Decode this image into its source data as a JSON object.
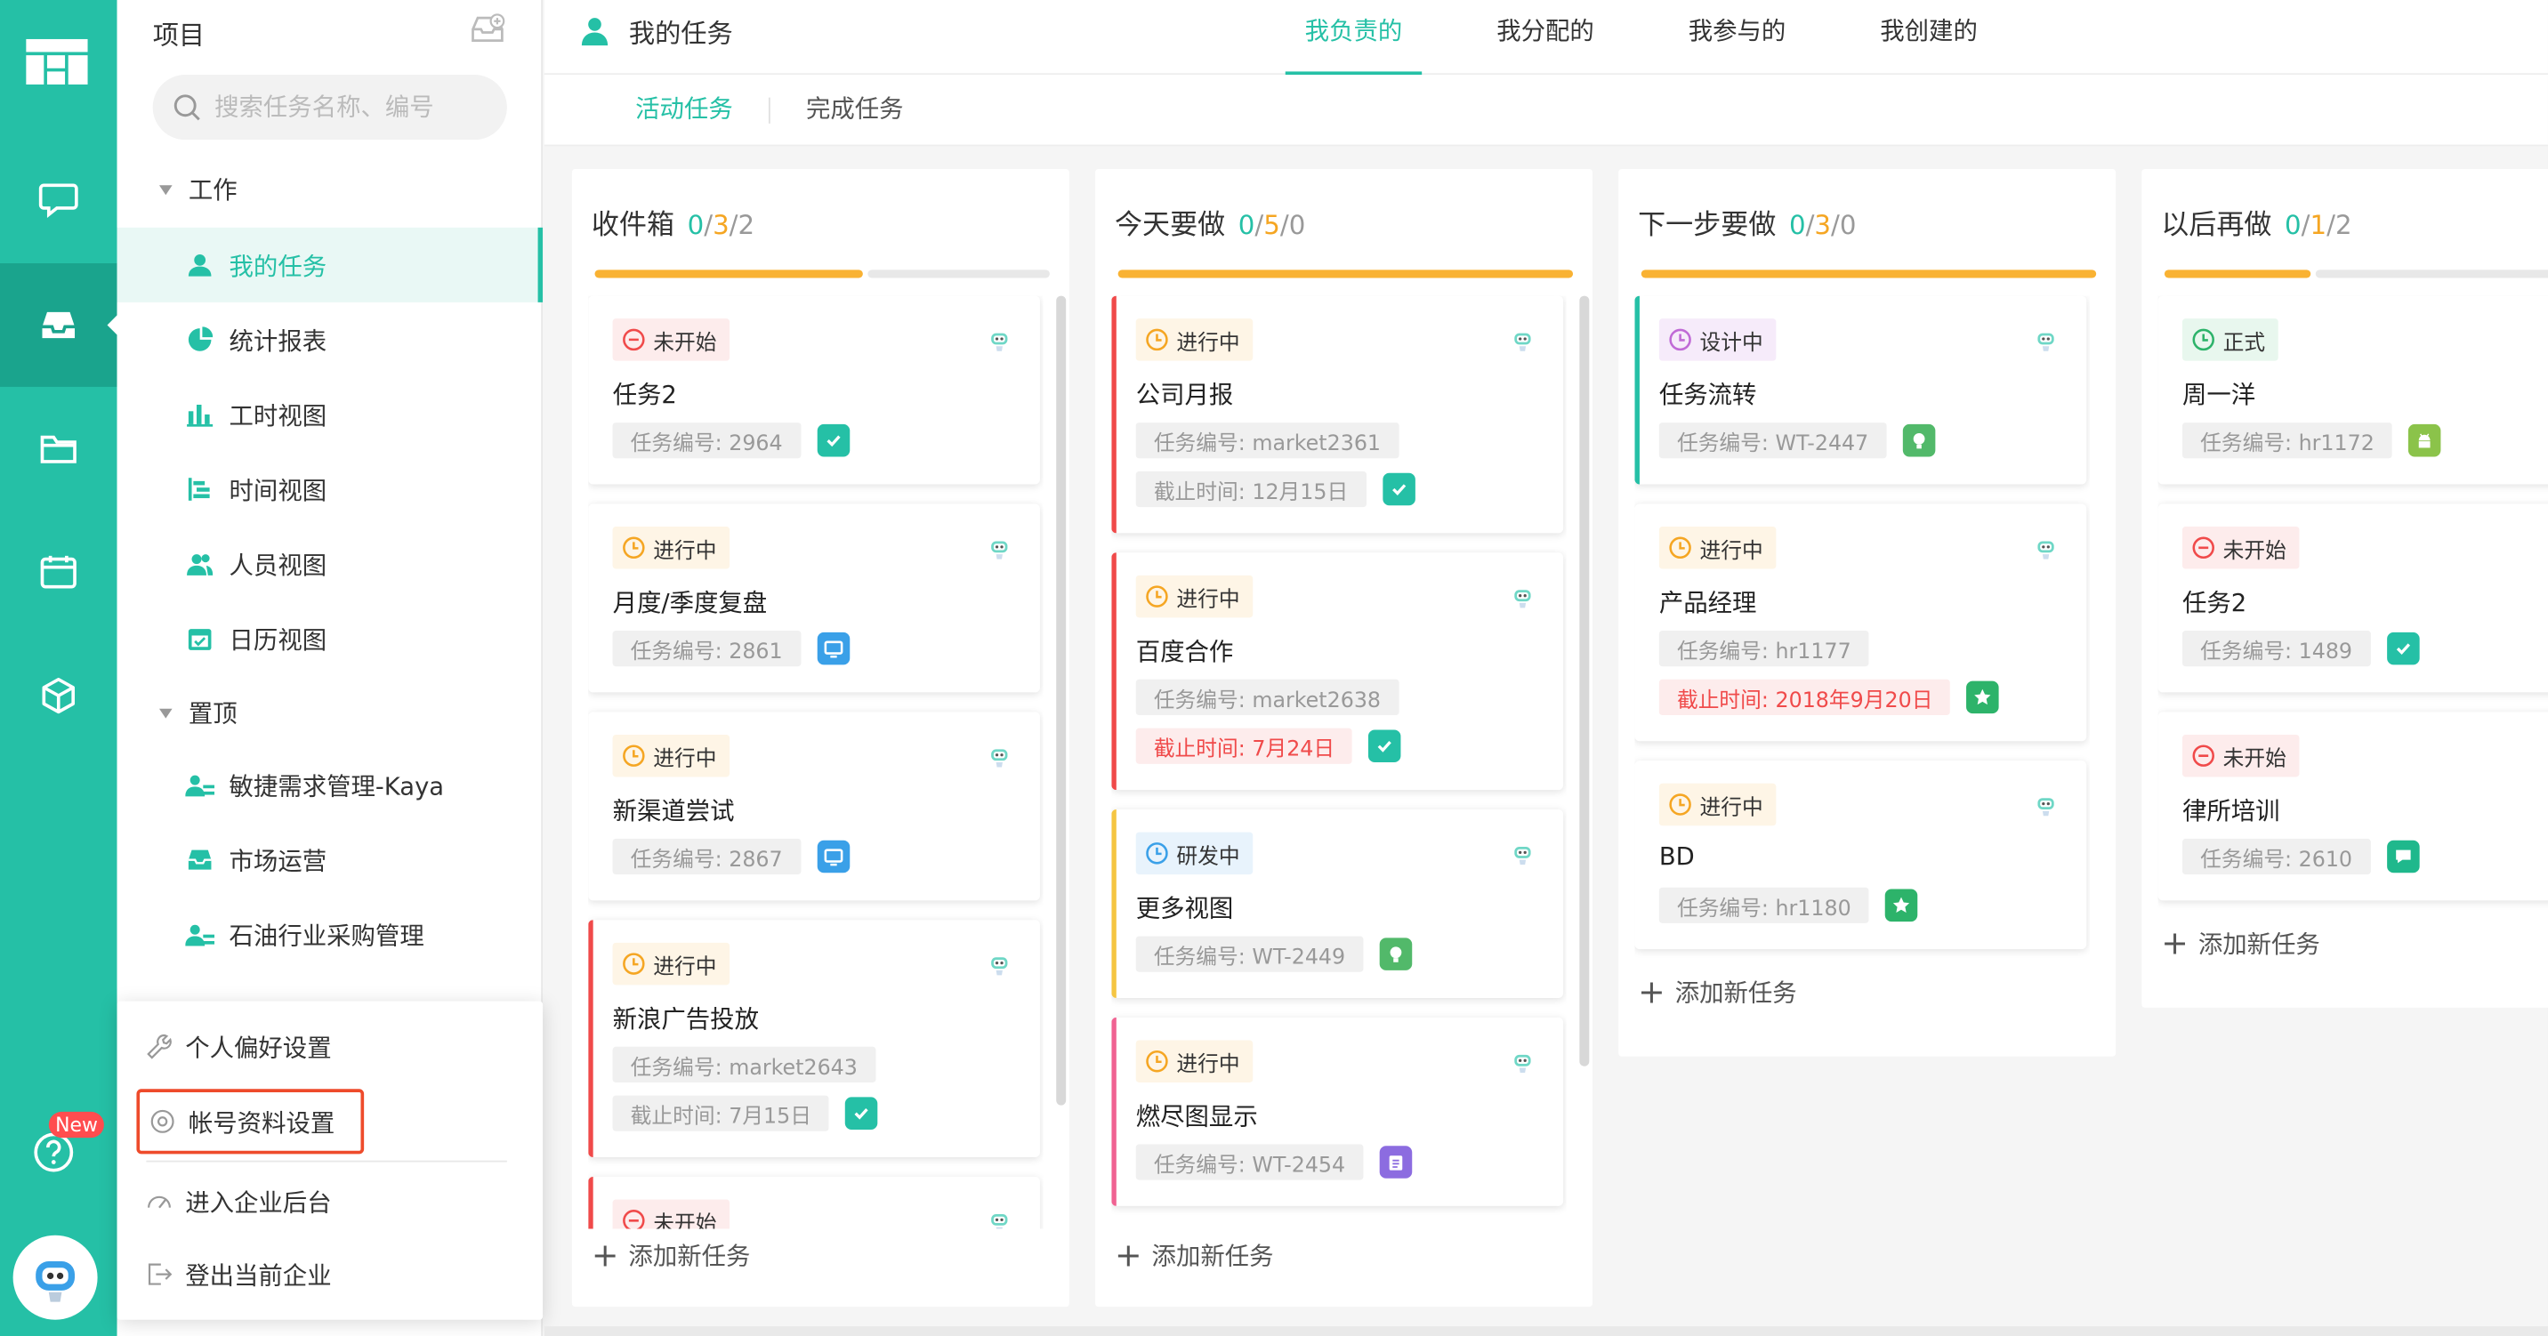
{
  "header": {
    "title": "我的任务",
    "tabs": [
      "我负责的",
      "我分配的",
      "我参与的",
      "我创建的"
    ]
  },
  "subtabs": [
    "活动任务",
    "完成任务"
  ],
  "sidebar": {
    "title": "项目",
    "search_placeholder": "搜索任务名称、编号",
    "group_work": "工作",
    "work_items": [
      "我的任务",
      "统计报表",
      "工时视图",
      "时间视图",
      "人员视图",
      "日历视图"
    ],
    "group_pinned": "置顶",
    "pinned_items": [
      "敏捷需求管理-Kaya",
      "市场运营",
      "石油行业采购管理"
    ]
  },
  "rail": {
    "new_badge": "New"
  },
  "popup_menu": [
    "个人偏好设置",
    "帐号资料设置",
    "进入企业后台",
    "登出当前企业"
  ],
  "add_task_label": "添加新任务",
  "columns": [
    {
      "title": "收件箱",
      "counts": [
        "0",
        "3",
        "2"
      ],
      "progress": {
        "teal": 0,
        "orange": 0.6,
        "grey": 0.4
      },
      "cards": [
        {
          "status": "未开始",
          "status_color": "#f04a4a",
          "status_bg": "#fdecec",
          "name": "任务2",
          "code": "任务编号: 2964",
          "deadline": "",
          "icon": "checkbox",
          "icon_color": "#25c0a6",
          "stripe": ""
        },
        {
          "status": "进行中",
          "status_color": "#f5a623",
          "status_bg": "#fef5e6",
          "name": "月度/季度复盘",
          "code": "任务编号: 2861",
          "deadline": "",
          "icon": "monitor",
          "icon_color": "#3aa0e8",
          "stripe": ""
        },
        {
          "status": "进行中",
          "status_color": "#f5a623",
          "status_bg": "#fef5e6",
          "name": "新渠道尝试",
          "code": "任务编号: 2867",
          "deadline": "",
          "icon": "monitor",
          "icon_color": "#3aa0e8",
          "stripe": ""
        },
        {
          "status": "进行中",
          "status_color": "#f5a623",
          "status_bg": "#fef5e6",
          "name": "新浪广告投放",
          "code": "任务编号: market2643",
          "deadline": "截止时间: 7月15日",
          "icon": "checkbox",
          "icon_color": "#25c0a6",
          "stripe": "#f04a4a"
        },
        {
          "status": "未开始",
          "status_color": "#f04a4a",
          "status_bg": "#fdecec",
          "name": "",
          "code": "",
          "deadline": "",
          "icon": "",
          "icon_color": "",
          "stripe": "#f04a4a"
        }
      ]
    },
    {
      "title": "今天要做",
      "counts": [
        "0",
        "5",
        "0"
      ],
      "progress": {
        "teal": 0,
        "orange": 1,
        "grey": 0
      },
      "cards": [
        {
          "status": "进行中",
          "status_color": "#f5a623",
          "status_bg": "#fef5e6",
          "name": "公司月报",
          "code": "任务编号: market2361",
          "deadline": "截止时间: 12月15日",
          "deadline_red": false,
          "icon": "checkbox",
          "icon_color": "#25c0a6",
          "stripe": "#f04a4a"
        },
        {
          "status": "进行中",
          "status_color": "#f5a623",
          "status_bg": "#fef5e6",
          "name": "百度合作",
          "code": "任务编号: market2638",
          "deadline": "截止时间: 7月24日",
          "deadline_red": true,
          "icon": "checkbox",
          "icon_color": "#25c0a6",
          "stripe": "#f04a4a"
        },
        {
          "status": "研发中",
          "status_color": "#3aa0e8",
          "status_bg": "#e8f3fc",
          "name": "更多视图",
          "code": "任务编号: WT-2449",
          "deadline": "",
          "icon": "bulb",
          "icon_color": "#52b96a",
          "stripe": "#f5c542"
        },
        {
          "status": "进行中",
          "status_color": "#f5a623",
          "status_bg": "#fef5e6",
          "name": "燃尽图显示",
          "code": "任务编号: WT-2454",
          "deadline": "",
          "icon": "clipboard",
          "icon_color": "#8c6ce0",
          "stripe": "#f06292"
        }
      ]
    },
    {
      "title": "下一步要做",
      "counts": [
        "0",
        "3",
        "0"
      ],
      "progress": {
        "teal": 0,
        "orange": 1,
        "grey": 0
      },
      "cards": [
        {
          "status": "设计中",
          "status_color": "#c06ad6",
          "status_bg": "#f6ebfa",
          "name": "任务流转",
          "code": "任务编号: WT-2447",
          "deadline": "",
          "icon": "bulb",
          "icon_color": "#52b96a",
          "stripe": "#25c0a6"
        },
        {
          "status": "进行中",
          "status_color": "#f5a623",
          "status_bg": "#fef5e6",
          "name": "产品经理",
          "code": "任务编号: hr1177",
          "deadline": "截止时间: 2018年9月20日",
          "deadline_red": true,
          "icon": "star",
          "icon_color": "#2db36a",
          "stripe": ""
        },
        {
          "status": "进行中",
          "status_color": "#f5a623",
          "status_bg": "#fef5e6",
          "name": "BD",
          "code": "任务编号: hr1180",
          "deadline": "",
          "icon": "star",
          "icon_color": "#2db36a",
          "stripe": ""
        }
      ]
    },
    {
      "title": "以后再做",
      "counts": [
        "0",
        "1",
        "2"
      ],
      "progress": {
        "teal": 0,
        "orange": 0.333,
        "grey": 0.667
      },
      "cards": [
        {
          "status": "正式",
          "status_color": "#2db36a",
          "status_bg": "#e8f7ee",
          "name": "周一洋",
          "code": "任务编号: hr1172",
          "deadline": "",
          "icon": "android",
          "icon_color": "#8bc34a",
          "stripe": ""
        },
        {
          "status": "未开始",
          "status_color": "#f04a4a",
          "status_bg": "#fdecec",
          "name": "任务2",
          "code": "任务编号: 1489",
          "deadline": "",
          "icon": "checkbox",
          "icon_color": "#25c0a6",
          "stripe": ""
        },
        {
          "status": "未开始",
          "status_color": "#f04a4a",
          "status_bg": "#fdecec",
          "name": "律所培训",
          "code": "任务编号: 2610",
          "deadline": "",
          "icon": "chat",
          "icon_color": "#1fb88c",
          "stripe": ""
        }
      ]
    }
  ]
}
